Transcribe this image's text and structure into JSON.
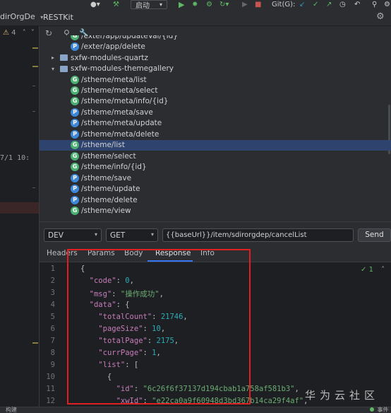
{
  "toolbar": {
    "run_config": "启动",
    "git_label": "Git(G):"
  },
  "header": {
    "left_title": "dirOrgDe",
    "panel_title": "RESTKit"
  },
  "left_strip": {
    "warning_count": "4",
    "date_text": "7/1 10:"
  },
  "tree": {
    "rows": [
      {
        "type": "leaf",
        "method": "G",
        "label": "/exter/app/updateVal/{id}"
      },
      {
        "type": "leaf",
        "method": "P",
        "label": "/exter/app/delete"
      },
      {
        "type": "folder",
        "expanded": false,
        "label": "sxfw-modules-quartz"
      },
      {
        "type": "folder",
        "expanded": true,
        "label": "sxfw-modules-themegallery"
      },
      {
        "type": "leaf",
        "method": "G",
        "label": "/stheme/meta/list"
      },
      {
        "type": "leaf",
        "method": "G",
        "label": "/stheme/meta/select"
      },
      {
        "type": "leaf",
        "method": "G",
        "label": "/stheme/meta/info/{id}"
      },
      {
        "type": "leaf",
        "method": "P",
        "label": "/stheme/meta/save"
      },
      {
        "type": "leaf",
        "method": "P",
        "label": "/stheme/meta/update"
      },
      {
        "type": "leaf",
        "method": "P",
        "label": "/stheme/meta/delete"
      },
      {
        "type": "leaf",
        "method": "G",
        "label": "/stheme/list",
        "selected": true
      },
      {
        "type": "leaf",
        "method": "G",
        "label": "/stheme/select"
      },
      {
        "type": "leaf",
        "method": "G",
        "label": "/stheme/info/{id}"
      },
      {
        "type": "leaf",
        "method": "P",
        "label": "/stheme/save"
      },
      {
        "type": "leaf",
        "method": "P",
        "label": "/stheme/update"
      },
      {
        "type": "leaf",
        "method": "P",
        "label": "/stheme/delete"
      },
      {
        "type": "leaf",
        "method": "G",
        "label": "/stheme/view"
      }
    ]
  },
  "request": {
    "env": "DEV",
    "method": "GET",
    "url": "{{baseUrl}}/item/sdirorgdep/cancelList",
    "send_label": "Send"
  },
  "tabs": [
    "Headers",
    "Params",
    "Body",
    "Response",
    "Info"
  ],
  "active_tab": "Response",
  "editor": {
    "inspection_count": "1",
    "lines": [
      [
        [
          "p",
          "{"
        ]
      ],
      [
        [
          "p",
          "  "
        ],
        [
          "k",
          "\"code\""
        ],
        [
          "p",
          ": "
        ],
        [
          "n",
          "0"
        ],
        [
          "p",
          ","
        ]
      ],
      [
        [
          "p",
          "  "
        ],
        [
          "k",
          "\"msg\""
        ],
        [
          "p",
          ": "
        ],
        [
          "s",
          "\"操作成功\""
        ],
        [
          "p",
          ","
        ]
      ],
      [
        [
          "p",
          "  "
        ],
        [
          "k",
          "\"data\""
        ],
        [
          "p",
          ": {"
        ]
      ],
      [
        [
          "p",
          "    "
        ],
        [
          "k",
          "\"totalCount\""
        ],
        [
          "p",
          ": "
        ],
        [
          "n",
          "21746"
        ],
        [
          "p",
          ","
        ]
      ],
      [
        [
          "p",
          "    "
        ],
        [
          "k",
          "\"pageSize\""
        ],
        [
          "p",
          ": "
        ],
        [
          "n",
          "10"
        ],
        [
          "p",
          ","
        ]
      ],
      [
        [
          "p",
          "    "
        ],
        [
          "k",
          "\"totalPage\""
        ],
        [
          "p",
          ": "
        ],
        [
          "n",
          "2175"
        ],
        [
          "p",
          ","
        ]
      ],
      [
        [
          "p",
          "    "
        ],
        [
          "k",
          "\"currPage\""
        ],
        [
          "p",
          ": "
        ],
        [
          "n",
          "1"
        ],
        [
          "p",
          ","
        ]
      ],
      [
        [
          "p",
          "    "
        ],
        [
          "k",
          "\"list\""
        ],
        [
          "p",
          ": ["
        ]
      ],
      [
        [
          "p",
          "      {"
        ]
      ],
      [
        [
          "p",
          "        "
        ],
        [
          "k",
          "\"id\""
        ],
        [
          "p",
          ": "
        ],
        [
          "s",
          "\"6c26f6f37137d194cbab1a758af581b3\""
        ],
        [
          "p",
          ","
        ]
      ],
      [
        [
          "p",
          "        "
        ],
        [
          "k",
          "\"xwId\""
        ],
        [
          "p",
          ": "
        ],
        [
          "s",
          "\"e22ca0a9f60948d3bd367b14ca29f4af\""
        ],
        [
          "p",
          ","
        ]
      ]
    ]
  },
  "watermark": "华为云社区",
  "status": {
    "left": "构建",
    "right": "事件日志"
  }
}
